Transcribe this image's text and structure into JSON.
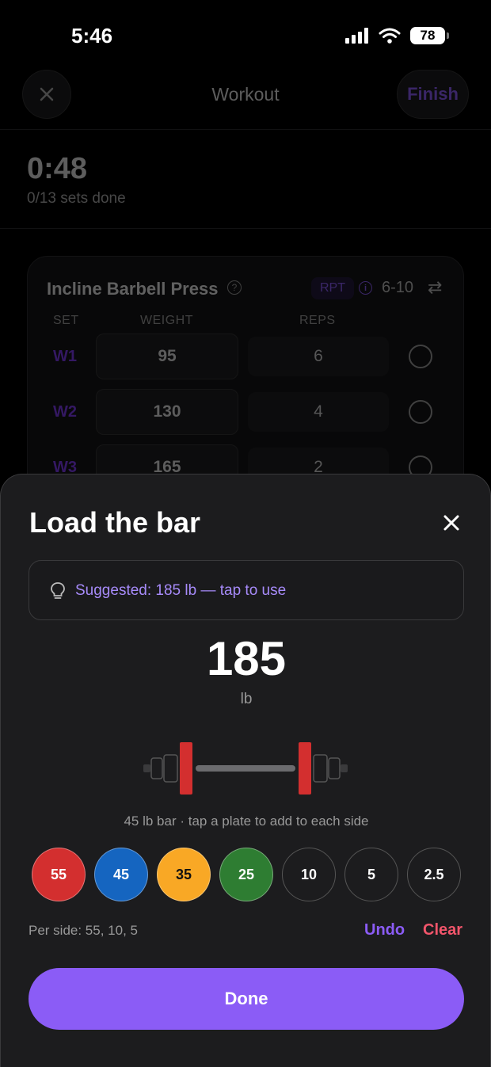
{
  "status_bar": {
    "time": "5:46",
    "battery": "78"
  },
  "nav": {
    "title": "Workout",
    "finish_label": "Finish"
  },
  "summary": {
    "timer": "0:48",
    "sets_done": "0/13 sets done"
  },
  "exercise": {
    "name": "Incline Barbell Press",
    "scheme_badge": "RPT",
    "rep_range": "6-10",
    "columns": {
      "set": "SET",
      "weight": "WEIGHT",
      "reps": "REPS"
    },
    "rows": [
      {
        "set": "W1",
        "weight": "95",
        "reps": "6"
      },
      {
        "set": "W2",
        "weight": "130",
        "reps": "4"
      },
      {
        "set": "W3",
        "weight": "165",
        "reps": "2"
      }
    ]
  },
  "sheet": {
    "title": "Load the bar",
    "suggestion": "Suggested: 185 lb — tap to use",
    "total": "185",
    "unit": "lb",
    "bar_caption": "45 lb bar · tap a plate to add to each side",
    "plates": [
      {
        "label": "55",
        "color": "#d32f2f",
        "text_color": "#ffffff"
      },
      {
        "label": "45",
        "color": "#1565c0",
        "text_color": "#ffffff"
      },
      {
        "label": "35",
        "color": "#f9a825",
        "text_color": "#111111"
      },
      {
        "label": "25",
        "color": "#2e7d32",
        "text_color": "#ffffff"
      },
      {
        "label": "10",
        "color": "#1c1c1e",
        "text_color": "#ffffff"
      },
      {
        "label": "5",
        "color": "#1c1c1e",
        "text_color": "#ffffff"
      },
      {
        "label": "2.5",
        "color": "#1c1c1e",
        "text_color": "#ffffff"
      }
    ],
    "per_side": "Per side: 55, 10, 5",
    "undo_label": "Undo",
    "clear_label": "Clear",
    "done_label": "Done"
  },
  "colors": {
    "accent": "#8b5cf6",
    "danger": "#f2556b"
  }
}
